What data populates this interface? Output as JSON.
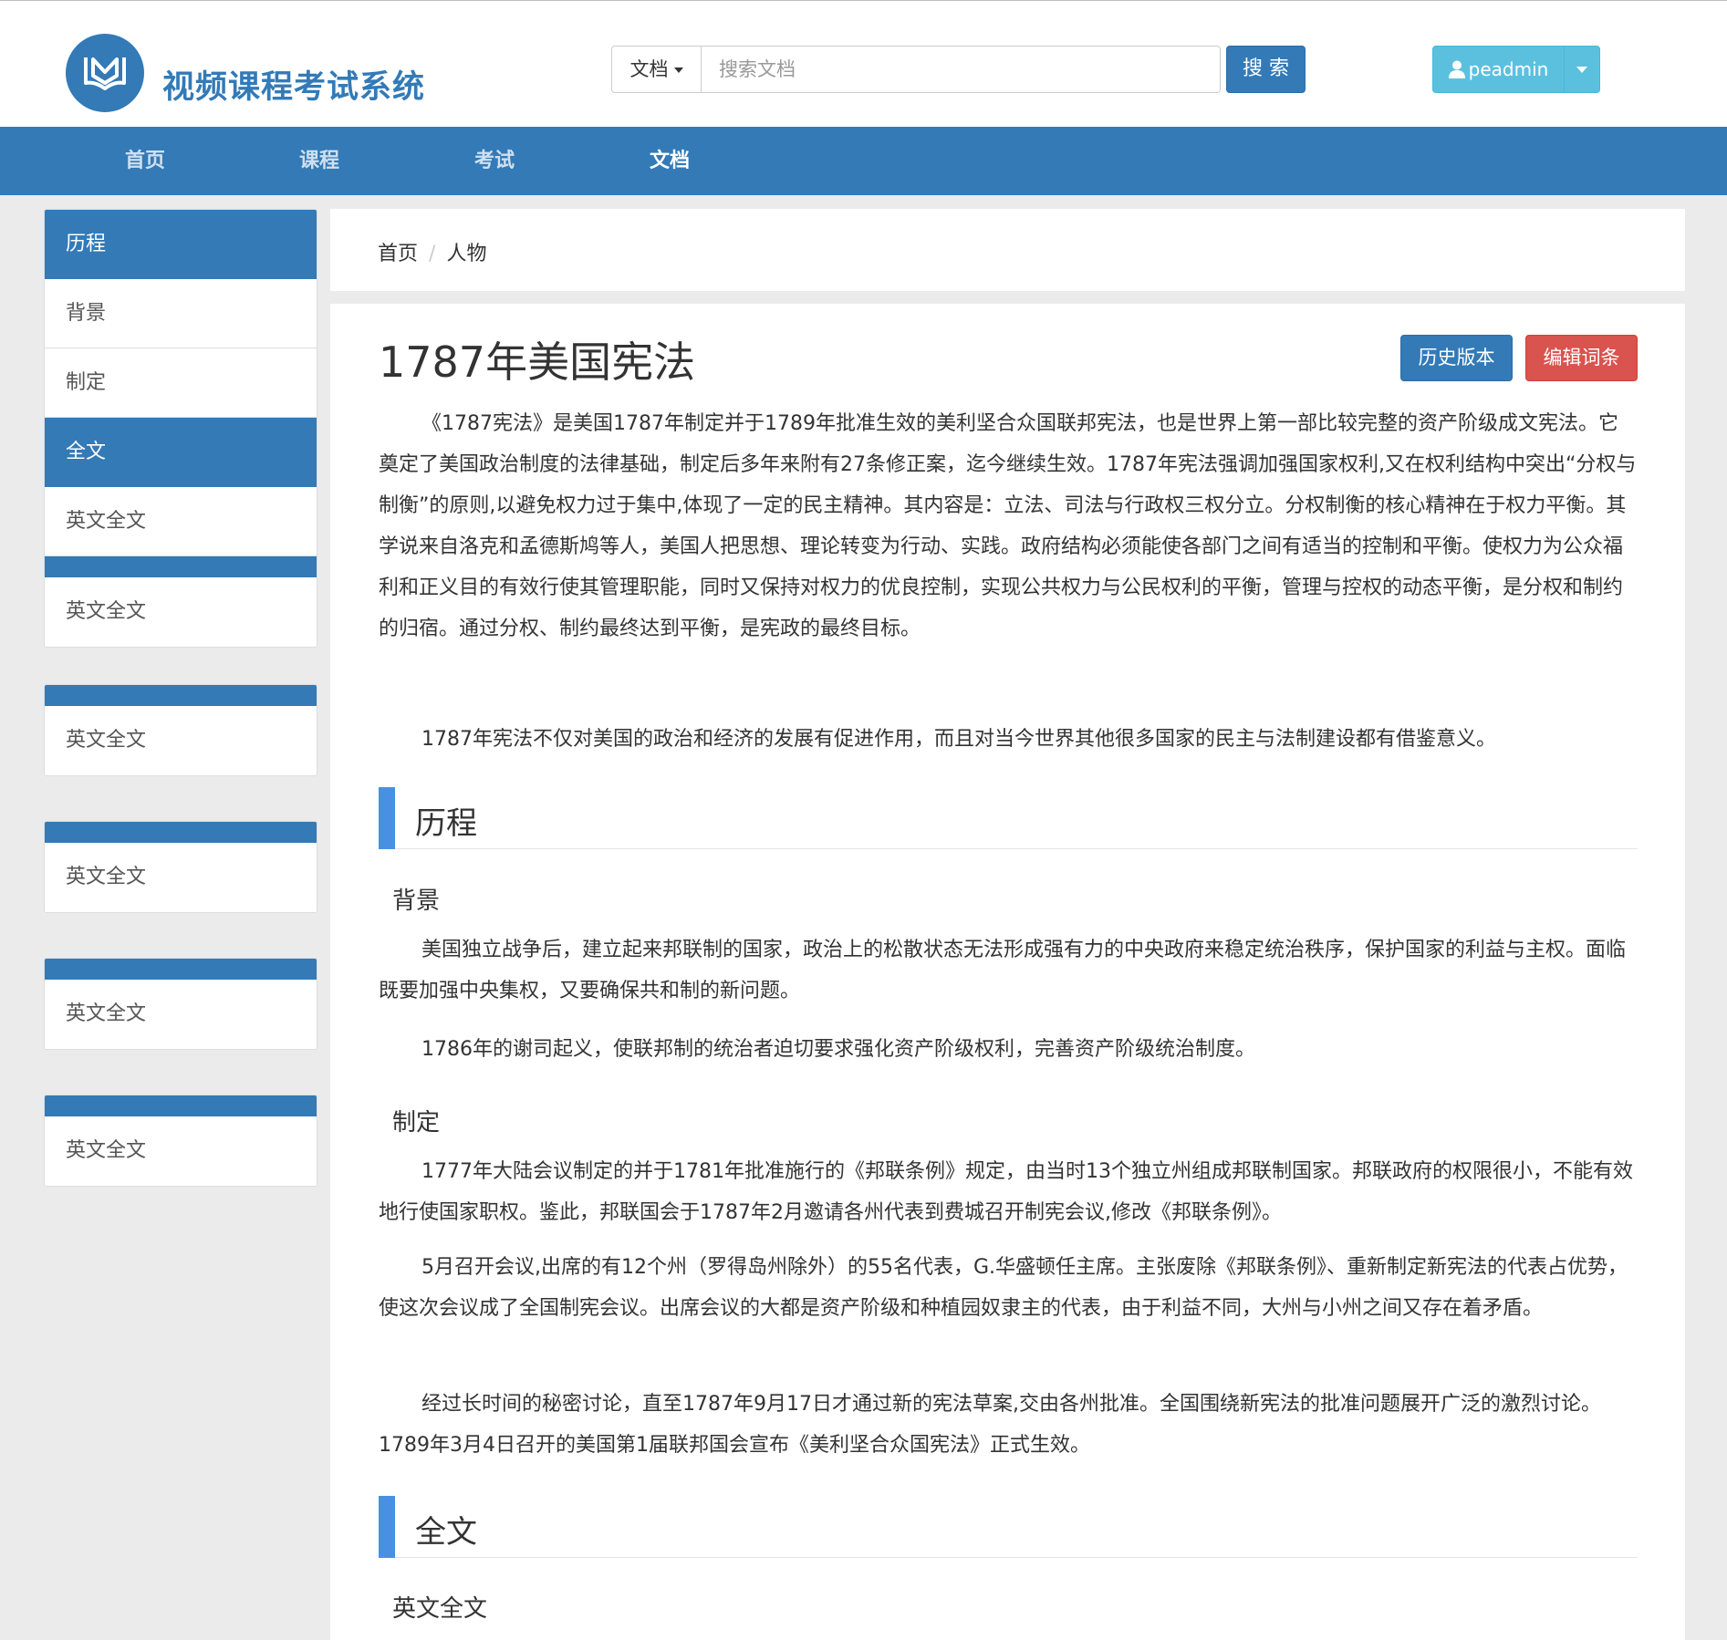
{
  "header": {
    "site_title": "视频课程考试系统",
    "search_type": "文档",
    "search_placeholder": "搜索文档",
    "search_button": "搜 索",
    "username": "peadmin"
  },
  "nav": [
    {
      "label": "首页"
    },
    {
      "label": "课程"
    },
    {
      "label": "考试"
    },
    {
      "label": "文档"
    }
  ],
  "sidebar": {
    "main_group": [
      "历程",
      "背景",
      "制定",
      "全文",
      "英文全文"
    ],
    "sub_items": [
      "英文全文",
      "英文全文",
      "英文全文",
      "英文全文",
      "英文全文"
    ]
  },
  "breadcrumb": [
    "首页",
    "人物"
  ],
  "doc": {
    "title": "1787年美国宪法",
    "history_button": "历史版本",
    "edit_button": "编辑词条",
    "intro": "《1787宪法》是美国1787年制定并于1789年批准生效的美利坚合众国联邦宪法，也是世界上第一部比较完整的资产阶级成文宪法。它奠定了美国政治制度的法律基础，制定后多年来附有27条修正案，迄今继续生效。1787年宪法强调加强国家权利,又在权利结构中突出“分权与制衡”的原则,以避免权力过于集中,体现了一定的民主精神。其内容是：立法、司法与行政权三权分立。分权制衡的核心精神在于权力平衡。其学说来自洛克和孟德斯鸠等人，美国人把思想、理论转变为行动、实践。政府结构必须能使各部门之间有适当的控制和平衡。使权力为公众福利和正义目的有效行使其管理职能，同时又保持对权力的优良控制，实现公共权力与公民权利的平衡，管理与控权的动态平衡，是分权和制约的归宿。通过分权、制约最终达到平衡，是宪政的最终目标。",
    "intro2": "1787年宪法不仅对美国的政治和经济的发展有促进作用，而且对当今世界其他很多国家的民主与法制建设都有借鉴意义。",
    "section1": "历程",
    "sub_background": "背景",
    "bg_p1": "美国独立战争后，建立起来邦联制的国家，政治上的松散状态无法形成强有力的中央政府来稳定统治秩序，保护国家的利益与主权。面临既要加强中央集权，又要确保共和制的新问题。",
    "bg_p2": "1786年的谢司起义，使联邦制的统治者迫切要求强化资产阶级权利，完善资产阶级统治制度。",
    "sub_making": "制定",
    "mk_p1": "1777年大陆会议制定的并于1781年批准施行的《邦联条例》规定，由当时13个独立州组成邦联制国家。邦联政府的权限很小，不能有效地行使国家职权。鉴此，邦联国会于1787年2月邀请各州代表到费城召开制宪会议,修改《邦联条例》。",
    "mk_p2": "5月召开会议,出席的有12个州（罗得岛州除外）的55名代表，G.华盛顿任主席。主张废除《邦联条例》、重新制定新宪法的代表占优势，使这次会议成了全国制宪会议。出席会议的大都是资产阶级和种植园奴隶主的代表，由于利益不同，大州与小州之间又存在着矛盾。",
    "mk_p3": "经过长时间的秘密讨论，直至1787年9月17日才通过新的宪法草案,交由各州批准。全国围绕新宪法的批准问题展开广泛的激烈讨论。1789年3月4日召开的美国第1届联邦国会宣布《美利坚合众国宪法》正式生效。",
    "section2": "全文",
    "sub_english": "英文全文"
  },
  "icons": {
    "logo": "book-logo-icon",
    "user": "user-icon",
    "caret": "caret-down-icon"
  },
  "colors": {
    "primary": "#337ab7",
    "info": "#5bc0de",
    "danger": "#d9534f",
    "section_bar": "#4a90e2"
  }
}
